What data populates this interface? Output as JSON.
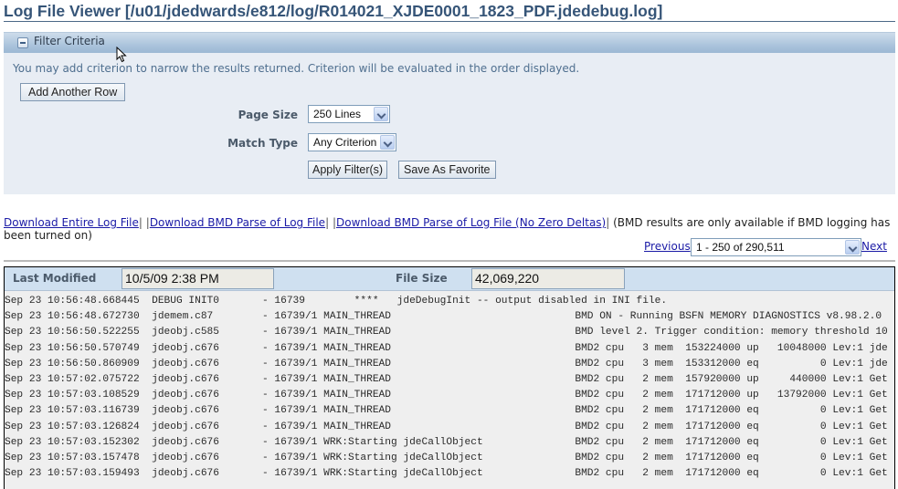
{
  "page": {
    "title": "Log File Viewer [/u01/jdedwards/e812/log/R014021_XJDE0001_1823_PDF.jdedebug.log]"
  },
  "filter": {
    "header": "Filter Criteria",
    "toggle_icon": "collapse-minus-icon",
    "hint": "You may add criterion to narrow the results returned. Criterion will be evaluated in the order displayed.",
    "add_row_label": "Add Another Row",
    "page_size_label": "Page Size",
    "page_size_value": "250 Lines",
    "match_type_label": "Match Type",
    "match_type_value": "Any Criterion",
    "apply_label": "Apply Filter(s)",
    "save_favorite_label": "Save As Favorite"
  },
  "links": {
    "download_entire": "Download Entire Log File",
    "download_bmd": "Download BMD Parse of Log File",
    "download_bmd_nozero": "Download BMD Parse of Log File (No Zero Deltas)",
    "separator": "|",
    "note": "(BMD results are only available if BMD logging has been turned on)"
  },
  "pager": {
    "previous": "Previous",
    "range": "1 - 250 of 290,511",
    "next": "Next"
  },
  "file_info": {
    "last_modified_label": "Last Modified",
    "last_modified_value": "10/5/09 2:38 PM",
    "file_size_label": "File Size",
    "file_size_value": "42,069,220"
  },
  "log_lines": [
    "Sep 23 10:56:48.668445  DEBUG INIT0       - 16739        ****   jdeDebugInit -- output disabled in INI file.",
    "Sep 23 10:56:48.672730  jdemem.c87        - 16739/1 MAIN_THREAD                              BMD ON - Running BSFN MEMORY DIAGNOSTICS v8.98.2.0",
    "Sep 23 10:56:50.522255  jdeobj.c585       - 16739/1 MAIN_THREAD                              BMD level 2. Trigger condition: memory threshold 10",
    "Sep 23 10:56:50.570749  jdeobj.c676       - 16739/1 MAIN_THREAD                              BMD2 cpu   3 mem  153224000 up   10048000 Lev:1 jde",
    "Sep 23 10:56:50.860909  jdeobj.c676       - 16739/1 MAIN_THREAD                              BMD2 cpu   3 mem  153312000 eq          0 Lev:1 jde",
    "Sep 23 10:57:02.075722  jdeobj.c676       - 16739/1 MAIN_THREAD                              BMD2 cpu   2 mem  157920000 up     440000 Lev:1 Get",
    "Sep 23 10:57:03.108529  jdeobj.c676       - 16739/1 MAIN_THREAD                              BMD2 cpu   2 mem  171712000 up   13792000 Lev:1 Get",
    "Sep 23 10:57:03.116739  jdeobj.c676       - 16739/1 MAIN_THREAD                              BMD2 cpu   2 mem  171712000 eq          0 Lev:1 Get",
    "Sep 23 10:57:03.126824  jdeobj.c676       - 16739/1 MAIN_THREAD                              BMD2 cpu   2 mem  171712000 eq          0 Lev:1 Get",
    "Sep 23 10:57:03.152302  jdeobj.c676       - 16739/1 WRK:Starting jdeCallObject               BMD2 cpu   2 mem  171712000 eq          0 Lev:1 Get",
    "Sep 23 10:57:03.157478  jdeobj.c676       - 16739/1 WRK:Starting jdeCallObject               BMD2 cpu   2 mem  171712000 eq          0 Lev:1 Get",
    "Sep 23 10:57:03.159493  jdeobj.c676       - 16739/1 WRK:Starting jdeCallObject               BMD2 cpu   2 mem  171712000 eq          0 Lev:1 Get"
  ],
  "colors": {
    "title": "#365578",
    "link": "#1a1aa6",
    "filter_bg": "#e8edf4",
    "info_bar_bg": "#cfe0f0",
    "log_bg": "#efefef"
  }
}
